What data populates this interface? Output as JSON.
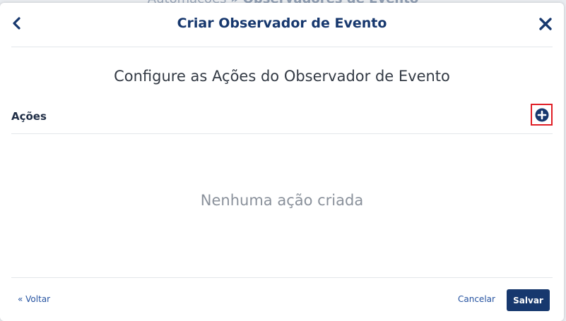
{
  "backdrop": {
    "crumb_parent": "Automações",
    "crumb_sep": "»",
    "crumb_current": "Observadores de Evento"
  },
  "modal": {
    "title": "Criar Observador de Evento",
    "back_icon": "chevron-left-icon",
    "close_icon": "close-icon",
    "subtitle": "Configure as Ações do Observador de Evento"
  },
  "actions_section": {
    "label": "Ações",
    "add_icon": "plus-circle-icon",
    "empty_message": "Nenhuma ação criada"
  },
  "footer": {
    "back_label": "« Voltar",
    "cancel_label": "Cancelar",
    "save_label": "Salvar"
  },
  "colors": {
    "primary": "#17386e",
    "highlight": "#e01e26",
    "link": "#2452a0"
  }
}
